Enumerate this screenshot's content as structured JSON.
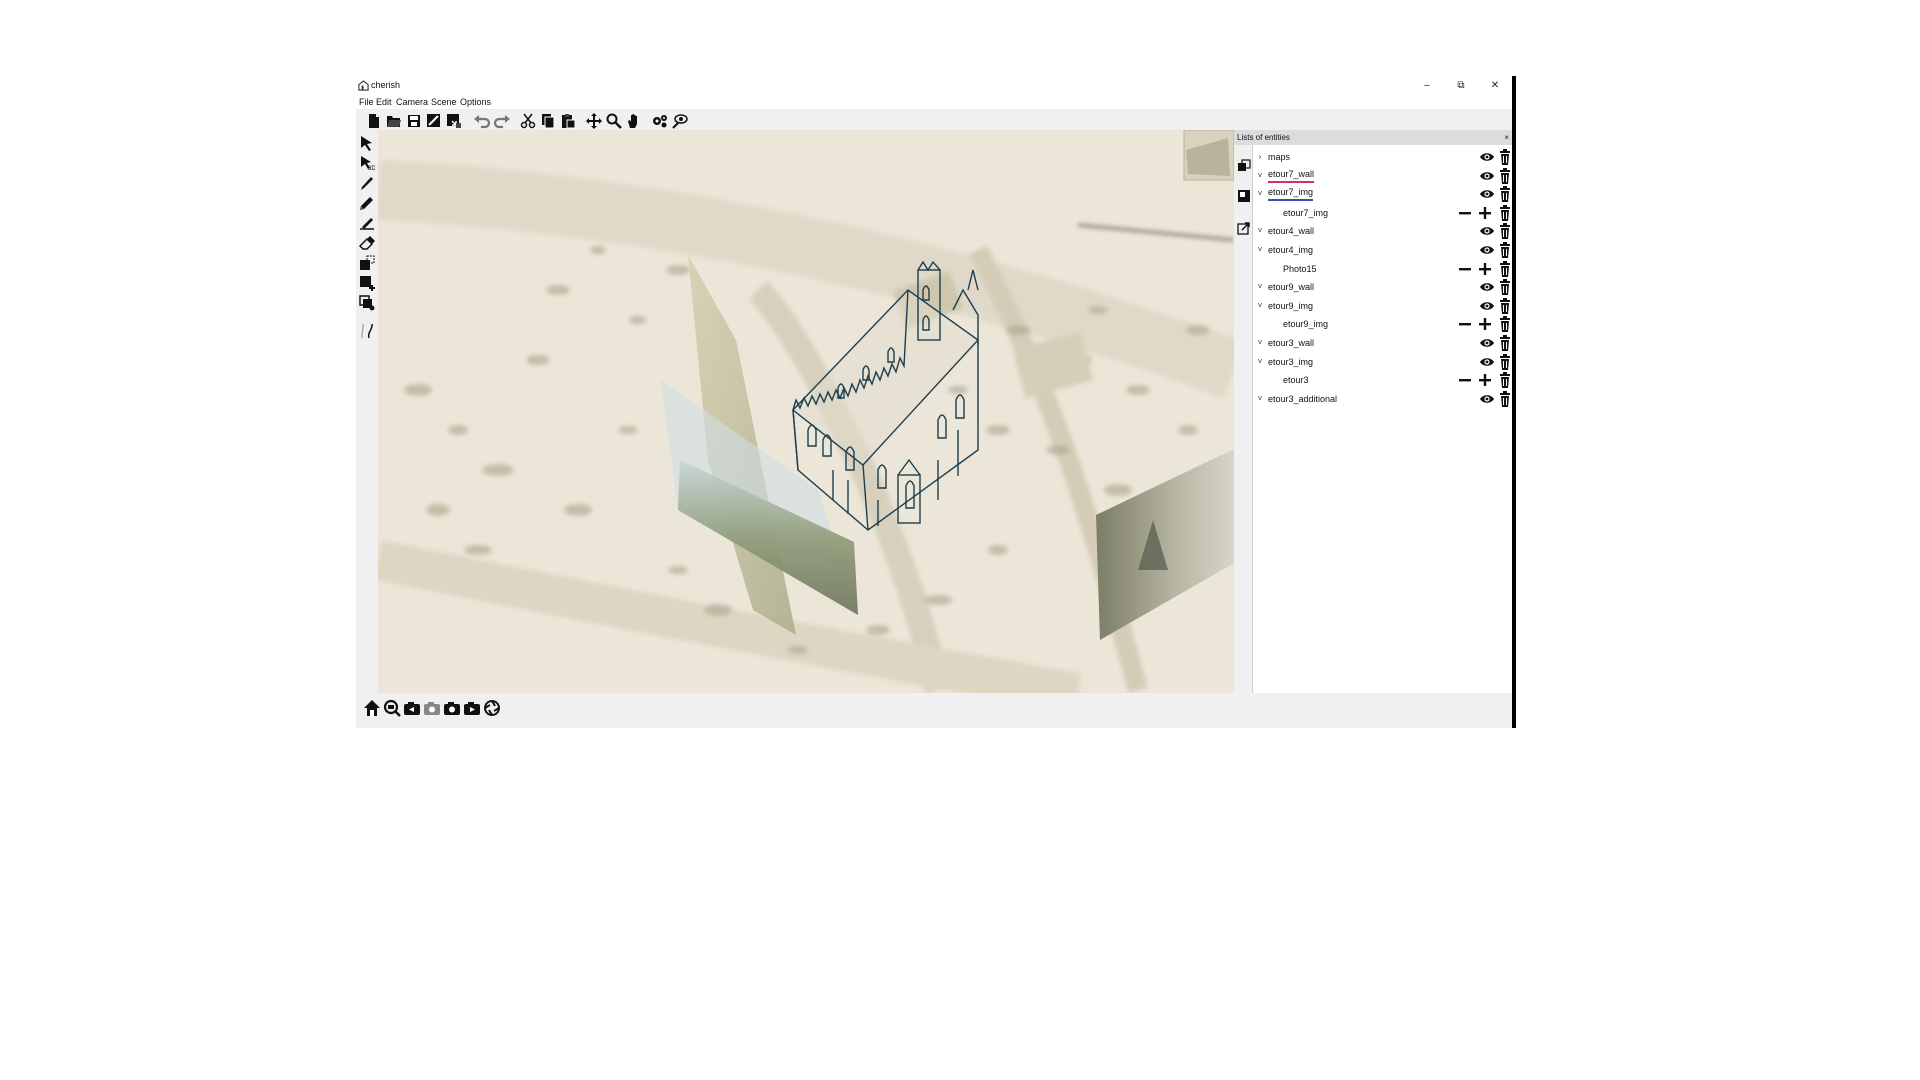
{
  "window": {
    "title": "cherish"
  },
  "controls": {
    "minimize": "–",
    "maximize": "⧉",
    "close": "✕"
  },
  "menu": [
    "File",
    "Edit",
    "Camera",
    "Scene",
    "Options"
  ],
  "panel": {
    "title": "Lists of entities",
    "close": "×",
    "entities": [
      {
        "label": "maps",
        "expanded": false,
        "child": false,
        "underline": ""
      },
      {
        "label": "etour7_wall",
        "expanded": true,
        "child": false,
        "underline": "red"
      },
      {
        "label": "etour7_img",
        "expanded": true,
        "child": false,
        "underline": "blue"
      },
      {
        "label": "etour7_img",
        "expanded": false,
        "child": true,
        "underline": ""
      },
      {
        "label": "etour4_wall",
        "expanded": true,
        "child": false,
        "underline": ""
      },
      {
        "label": "etour4_img",
        "expanded": true,
        "child": false,
        "underline": ""
      },
      {
        "label": "Photo15",
        "expanded": false,
        "child": true,
        "underline": ""
      },
      {
        "label": "etour9_wall",
        "expanded": true,
        "child": false,
        "underline": ""
      },
      {
        "label": "etour9_img",
        "expanded": true,
        "child": false,
        "underline": ""
      },
      {
        "label": "etour9_img",
        "expanded": false,
        "child": true,
        "underline": ""
      },
      {
        "label": "etour3_wall",
        "expanded": true,
        "child": false,
        "underline": ""
      },
      {
        "label": "etour3_img",
        "expanded": true,
        "child": false,
        "underline": ""
      },
      {
        "label": "etour3",
        "expanded": false,
        "child": true,
        "underline": ""
      },
      {
        "label": "etour3_additional",
        "expanded": true,
        "child": false,
        "underline": ""
      }
    ]
  },
  "colors": {
    "underline_red": "#d0345a",
    "underline_blue": "#3c4fb5",
    "sketch": "#1d3f4f",
    "map": "#e9e3d4"
  }
}
